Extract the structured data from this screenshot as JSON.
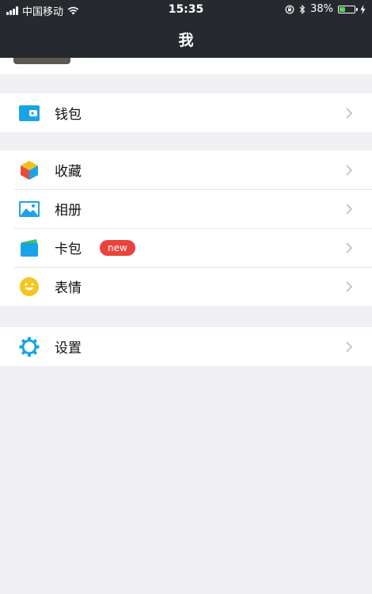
{
  "status_bar": {
    "carrier": "中国移动",
    "time": "15:35",
    "battery_percent": "38%",
    "battery_level": 0.38
  },
  "nav": {
    "title": "我"
  },
  "groups": [
    {
      "items": [
        {
          "label": "钱包",
          "icon": "wallet-icon"
        }
      ]
    },
    {
      "items": [
        {
          "label": "收藏",
          "icon": "favorites-cube-icon"
        },
        {
          "label": "相册",
          "icon": "photo-album-icon"
        },
        {
          "label": "卡包",
          "icon": "card-pack-icon",
          "badge": "new"
        },
        {
          "label": "表情",
          "icon": "smiley-icon"
        }
      ]
    },
    {
      "items": [
        {
          "label": "设置",
          "icon": "gear-icon"
        }
      ]
    }
  ],
  "colors": {
    "header_bg": "#26292e",
    "page_bg": "#efeff4",
    "badge_bg": "#e8443b",
    "icon_blue": "#1aa3e8",
    "battery_green": "#4cd964"
  }
}
